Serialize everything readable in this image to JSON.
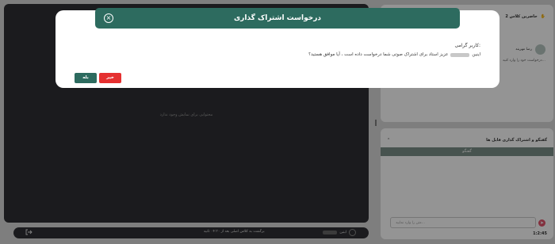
{
  "stage": {
    "empty_text": "محتوایی برای نمایش وجود ندارد"
  },
  "bottom_bar": {
    "recording_text": "برگشت به کلاس اصلی بعد از ۰۴:۳۰ ثانیه",
    "user_label": "اینین"
  },
  "attendees": {
    "title": "حاضرین کلاس 2",
    "user_name": "رضا مهربند",
    "note": "درخواست خود را وارد کنید..."
  },
  "chat": {
    "title": "گفتگو و اشتراک گذاری فایل ها",
    "tab_label": "گفتگو",
    "input_placeholder": "متن را وارد نمایید...",
    "time": "1:2:45"
  },
  "modal": {
    "title": "درخواست اشتراک گذاری",
    "salutation": "کاربر گرامی:",
    "message_prefix": "اینین",
    "message_suffix": "عزیز استاد برای اشتراک صوتی شما درخواست داده است ، آیا موافق هستید؟",
    "yes_label": "بله",
    "no_label": "خیر",
    "close_glyph": "×"
  },
  "colors": {
    "primary": "#2d6b5f",
    "danger": "#e53030",
    "stage_bg": "#2f3034"
  }
}
